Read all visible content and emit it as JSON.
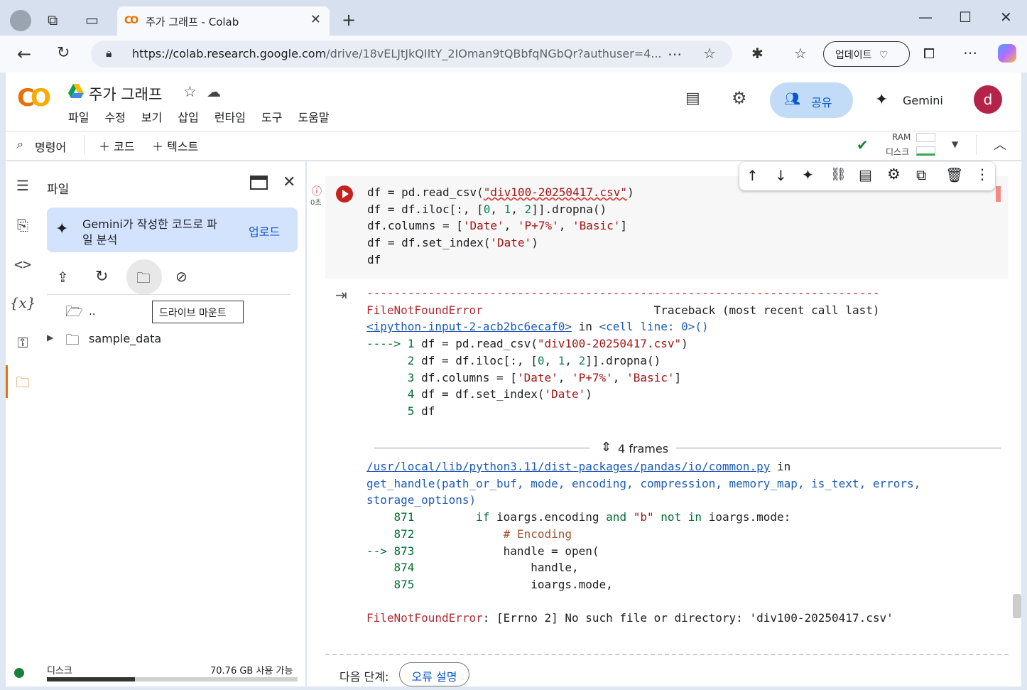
{
  "browser": {
    "tab_title": "주가 그래프 - Colab",
    "url_host": "https://colab.research.google.com",
    "url_path": "/drive/18vELJtJkQIItY_2IOman9tQBbfqNGbQr?authuser=4...",
    "update_label": "업데이트"
  },
  "app": {
    "logo": "CO",
    "title": "주가 그래프",
    "menu": [
      "파일",
      "수정",
      "보기",
      "삽입",
      "런타임",
      "도구",
      "도움말"
    ],
    "share_label": "공유",
    "gemini_label": "Gemini",
    "avatar_letter": "d"
  },
  "toolbar": {
    "command_label": "명령어",
    "add_code": "코드",
    "add_text": "텍스트",
    "ram_label": "RAM",
    "disk_label": "디스크"
  },
  "files_panel": {
    "title": "파일",
    "gemini_card_text_1": "Gemini가 작성한 코드로 파",
    "gemini_card_text_2": "일 분석",
    "upload_label": "업로드",
    "tooltip": "드라이브 마운트",
    "parent_dir": "..",
    "folder": "sample_data",
    "disk_label": "디스크",
    "disk_free": "70.76 GB 사용 가능",
    "disk_used_fraction": 0.35
  },
  "cell": {
    "exec_time": "0초"
  },
  "output": {
    "frames_label": "4 frames",
    "next_step_label": "다음 단계:",
    "explain_error_label": "오류 설명"
  },
  "colors": {
    "accent": "#0b57d0",
    "error_red": "#c5221f",
    "colab_orange": "#e8710a"
  }
}
